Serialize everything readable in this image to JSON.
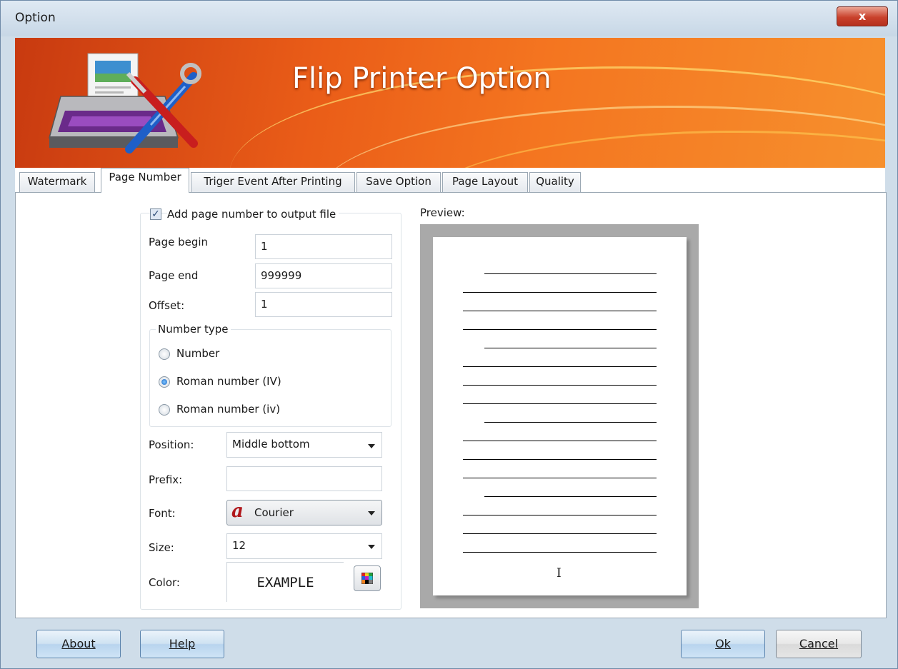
{
  "window": {
    "title": "Option",
    "close_symbol": "x"
  },
  "banner": {
    "title": "Flip Printer Option"
  },
  "tabs": [
    {
      "label": "Watermark",
      "active": false
    },
    {
      "label": "Page Number",
      "active": true
    },
    {
      "label": "Triger Event After Printing",
      "active": false
    },
    {
      "label": "Save Option",
      "active": false
    },
    {
      "label": "Page Layout",
      "active": false
    },
    {
      "label": "Quality",
      "active": false
    }
  ],
  "page_number": {
    "add_checkbox_label": "Add page number to output file",
    "add_checked": true,
    "page_begin_label": "Page begin",
    "page_begin_value": "1",
    "page_end_label": "Page end",
    "page_end_value": "999999",
    "offset_label": "Offset:",
    "offset_value": "1",
    "number_type_title": "Number type",
    "number_types": [
      {
        "label": "Number",
        "selected": false
      },
      {
        "label": "Roman number (IV)",
        "selected": true
      },
      {
        "label": "Roman number (iv)",
        "selected": false
      }
    ],
    "position_label": "Position:",
    "position_value": "Middle bottom",
    "prefix_label": "Prefix:",
    "prefix_value": "",
    "font_label": "Font:",
    "font_icon_glyph": "a",
    "font_value": "Courier",
    "size_label": "Size:",
    "size_value": "12",
    "color_label": "Color:",
    "color_example": "EXAMPLE"
  },
  "preview": {
    "label": "Preview:",
    "page_number_text": "I"
  },
  "buttons": {
    "about": "About",
    "help": "Help",
    "ok": "Ok",
    "cancel": "Cancel"
  },
  "colors": {
    "banner_orange": "#f47520",
    "title_blue": "#cfdde9"
  }
}
